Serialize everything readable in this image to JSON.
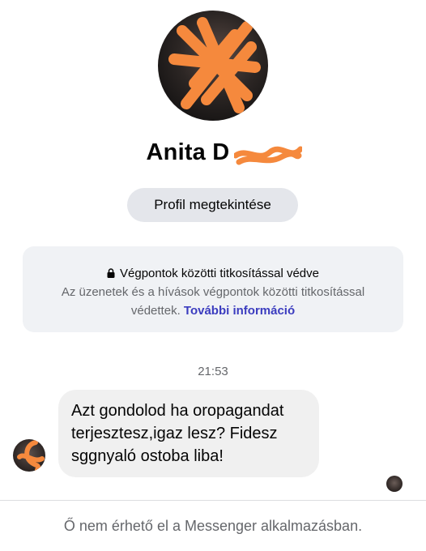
{
  "profile": {
    "name": "Anita D",
    "view_profile_label": "Profil megtekintése"
  },
  "encryption": {
    "title": "Végpontok közötti titkosítással védve",
    "description": "Az üzenetek és a hívások végpontok közötti titkosítással védettek.",
    "link": "További információ"
  },
  "conversation": {
    "timestamp": "21:53",
    "message": "Azt gondolod ha oropagandat terjesztesz,igaz lesz? Fidesz sggnyaló ostoba liba!"
  },
  "footer": {
    "notice": "Ő nem érhető el a Messenger alkalmazásban."
  },
  "colors": {
    "link": "#3b3cbf",
    "redaction": "#f5893d",
    "bubble": "#f0f0f0",
    "card": "#f0f2f5"
  },
  "icons": [
    "lock-icon",
    "redaction-scribble"
  ]
}
